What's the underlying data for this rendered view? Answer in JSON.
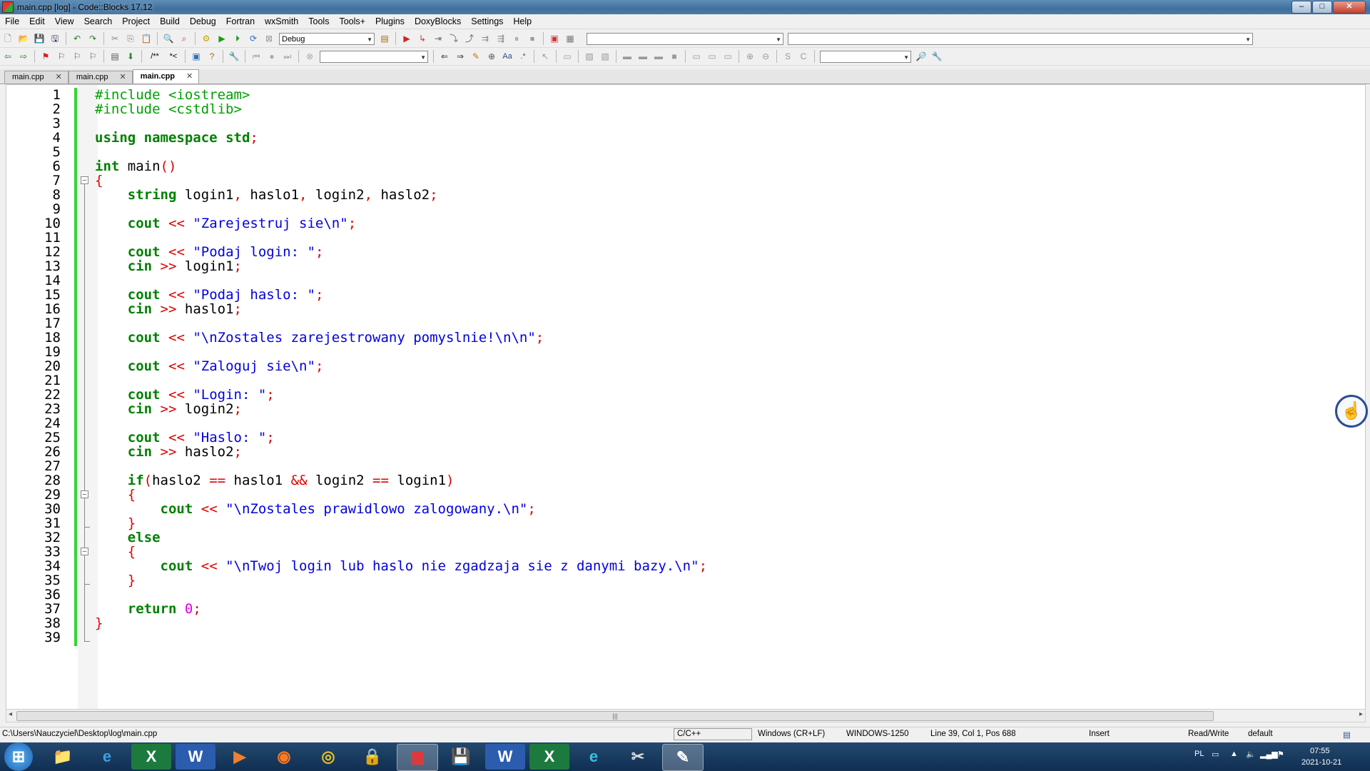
{
  "window": {
    "title": "main.cpp [log] - Code::Blocks 17.12"
  },
  "menu": [
    "File",
    "Edit",
    "View",
    "Search",
    "Project",
    "Build",
    "Debug",
    "Fortran",
    "wxSmith",
    "Tools",
    "Tools+",
    "Plugins",
    "DoxyBlocks",
    "Settings",
    "Help"
  ],
  "toolbar": {
    "build_target": "Debug"
  },
  "tabs": [
    {
      "label": "main.cpp",
      "active": false
    },
    {
      "label": "main.cpp",
      "active": false
    },
    {
      "label": "main.cpp",
      "active": true
    }
  ],
  "code_lines": [
    "#include <iostream>",
    "#include <cstdlib>",
    "",
    "using namespace std;",
    "",
    "int main()",
    "{",
    "    string login1, haslo1, login2, haslo2;",
    "",
    "    cout << \"Zarejestruj sie\\n\";",
    "",
    "    cout << \"Podaj login: \";",
    "    cin >> login1;",
    "",
    "    cout << \"Podaj haslo: \";",
    "    cin >> haslo1;",
    "",
    "    cout << \"\\nZostales zarejestrowany pomyslnie!\\n\\n\";",
    "",
    "    cout << \"Zaloguj sie\\n\";",
    "",
    "    cout << \"Login: \";",
    "    cin >> login2;",
    "",
    "    cout << \"Haslo: \";",
    "    cin >> haslo2;",
    "",
    "    if(haslo2 == haslo1 && login2 == login1)",
    "    {",
    "        cout << \"\\nZostales prawidlowo zalogowany.\\n\";",
    "    }",
    "    else",
    "    {",
    "        cout << \"\\nTwoj login lub haslo nie zgadzaja sie z danymi bazy.\\n\";",
    "    }",
    "",
    "    return 0;",
    "}",
    ""
  ],
  "status": {
    "path": "C:\\Users\\Nauczyciel\\Desktop\\log\\main.cpp",
    "language": "C/C++",
    "line_endings": "Windows (CR+LF)",
    "encoding": "WINDOWS-1250",
    "position": "Line 39, Col 1, Pos 688",
    "mode": "Insert",
    "access": "Read/Write",
    "profile": "default"
  },
  "taskbar": {
    "lang": "PL",
    "time": "07:55",
    "date": "2021-10-21"
  },
  "colors": {
    "preprocessor": "#00a000",
    "keyword": "#008000",
    "operator": "#e00000",
    "string": "#0000e0",
    "number": "#e000e0",
    "change_bar": "#36d436"
  },
  "icons": [
    "new-file-icon",
    "open-icon",
    "save-icon",
    "save-all-icon",
    "undo-icon",
    "redo-icon",
    "cut-icon",
    "copy-icon",
    "paste-icon",
    "find-icon",
    "replace-icon",
    "build-icon",
    "run-icon",
    "build-run-icon",
    "rebuild-icon",
    "abort-icon",
    "debug-icon",
    "hand-cursor-icon"
  ]
}
